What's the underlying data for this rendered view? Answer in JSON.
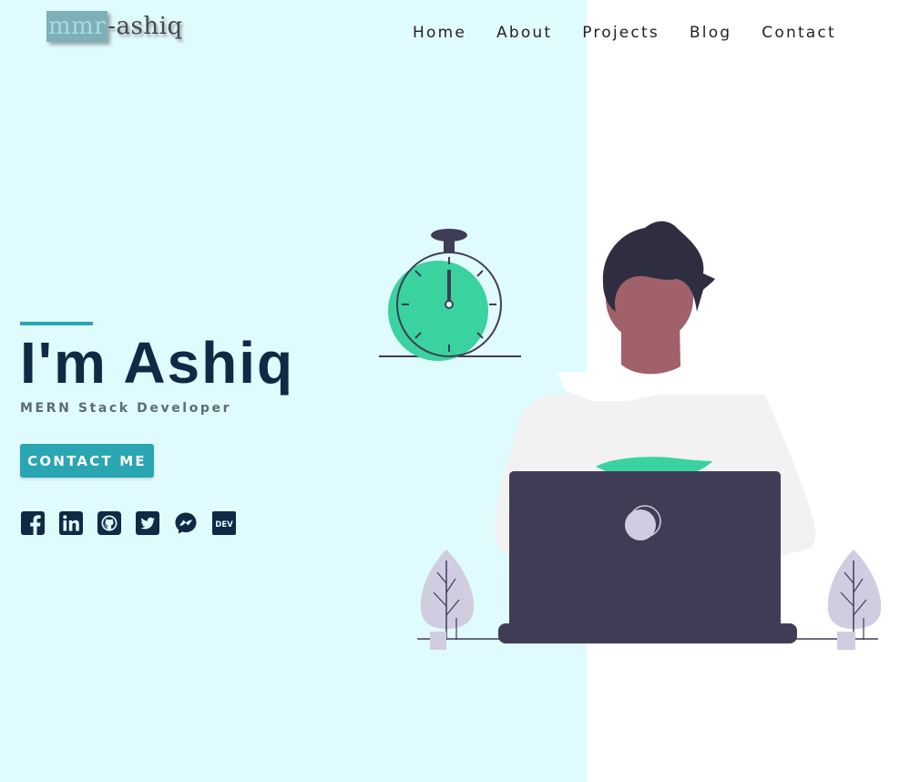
{
  "logo": {
    "boxed_part": "mmr",
    "rest": "-ashiq"
  },
  "nav": {
    "items": [
      {
        "label": "Home"
      },
      {
        "label": "About"
      },
      {
        "label": "Projects"
      },
      {
        "label": "Blog"
      },
      {
        "label": "Contact"
      }
    ]
  },
  "hero": {
    "name": "I'm Ashiq",
    "subtitle": "MERN Stack Developer",
    "cta_label": "CONTACT ME",
    "dev_badge": "DEV"
  },
  "socials": [
    {
      "icon": "facebook-icon"
    },
    {
      "icon": "linkedin-icon"
    },
    {
      "icon": "github-icon"
    },
    {
      "icon": "twitter-icon"
    },
    {
      "icon": "messenger-icon"
    },
    {
      "icon": "dev-icon"
    }
  ],
  "colors": {
    "left_background": "#e0fbfe",
    "accent": "#2aa5b2",
    "heading": "#0f2a44",
    "clock_green": "#3ad29f",
    "laptop": "#3f3d56",
    "plant": "#d0cde1"
  }
}
